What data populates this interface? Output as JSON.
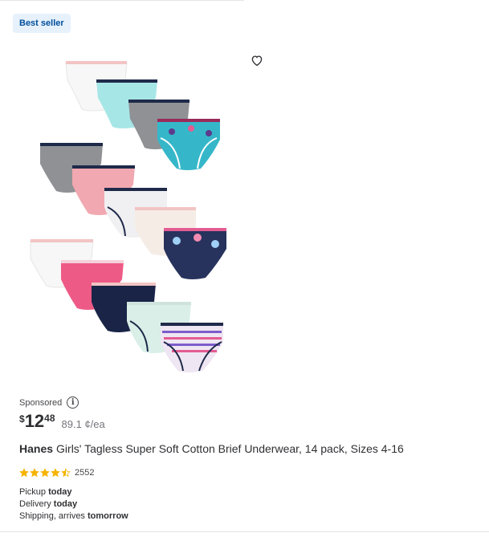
{
  "badge": {
    "label": "Best seller"
  },
  "favorite": {
    "icon": "heart-outline-icon"
  },
  "product_image": {
    "alt": "14 pack girls briefs"
  },
  "sponsored": {
    "label": "Sponsored",
    "icon": "info-icon",
    "glyph": "i"
  },
  "price": {
    "currency_symbol": "$",
    "whole": "12",
    "cents": "48",
    "unit_price": "89.1 ¢/ea"
  },
  "title": {
    "brand": "Hanes",
    "text": "Girls' Tagless Super Soft Cotton Brief Underwear, 14 pack, Sizes 4-16"
  },
  "rating": {
    "stars": 4.5,
    "review_count": "2552",
    "star_color": "#f5b400"
  },
  "fulfillment": {
    "pickup_label": "Pickup",
    "pickup_value": "today",
    "delivery_label": "Delivery",
    "delivery_value": "today",
    "shipping_label": "Shipping, arrives",
    "shipping_value": "tomorrow"
  }
}
